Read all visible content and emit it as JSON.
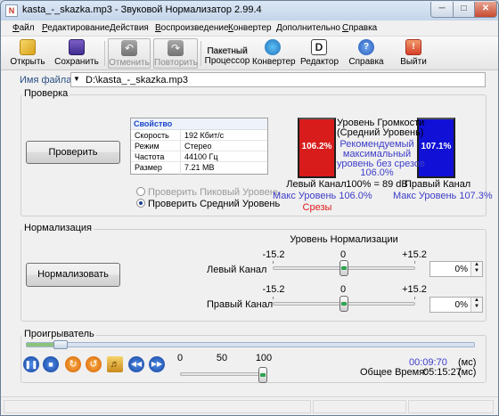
{
  "window": {
    "title": "kasta_-_skazka.mp3 - Звуковой Нормализатор 2.99.4",
    "app_icon_letter": "N",
    "controls": [
      "minimize",
      "maximize",
      "close"
    ]
  },
  "menu": [
    {
      "label": "Файл",
      "underline": "Ф",
      "rest": "айл"
    },
    {
      "label": "Редактирование",
      "underline": "Р",
      "rest": "едактирование"
    },
    {
      "label": "Действия",
      "underline": "Д",
      "rest": "ействия"
    },
    {
      "label": "Воспроизведение",
      "underline": "В",
      "rest": "оспроизведение"
    },
    {
      "label": "Конвертер",
      "underline": "К",
      "rest": "онвертер"
    },
    {
      "label": "Дополнительно",
      "underline": "Д",
      "rest": "ополнительно"
    },
    {
      "label": "Справка",
      "underline": "С",
      "rest": "правка"
    }
  ],
  "toolbar": {
    "open": "Открыть",
    "save": "Сохранить",
    "undo": "Отменить",
    "redo": "Повторить",
    "batch_line1": "Пакетный",
    "batch_line2": "Процессор",
    "converter": "Конвертер",
    "editor": "Редактор",
    "help": "Справка",
    "exit": "Выйти"
  },
  "file": {
    "label": "Имя файла:",
    "value": "D:\\kasta_-_skazka.mp3"
  },
  "check": {
    "group_title": "Проверка",
    "check_button": "Проверить",
    "properties": {
      "header": "Свойство",
      "rows": [
        {
          "key": "Скорость",
          "value": "192 Кбит/с"
        },
        {
          "key": "Режим",
          "value": "Стерео"
        },
        {
          "key": "Частота",
          "value": "44100 Гц"
        },
        {
          "key": "Размер",
          "value": "7.21 MB"
        }
      ]
    },
    "radio_peak": "Проверить Пиковый Уровень",
    "radio_average": "Проверить Средний Уровень",
    "selected_radio": "average",
    "loudness_title_line1": "Уровень Громкости",
    "loudness_title_line2": "(Средний Уровень)",
    "recommend_line1": "Рекомендуемый",
    "recommend_line2": "максимальный",
    "recommend_line3": "уровень без срезов",
    "recommend_value": "106.0%",
    "db_text": "100% = 89 dB",
    "left_meter_value": "106.2%",
    "right_meter_value": "107.1%",
    "left_meter_color": "#d81c1c",
    "right_meter_color": "#1010d6",
    "left_channel": "Левый Канал",
    "right_channel": "Правый Канал",
    "left_max": "Макс Уровень 106.0%",
    "right_max": "Макс Уровень 107.3%",
    "clipping": "Срезы"
  },
  "normalize": {
    "group_title": "Нормализация",
    "normalize_button": "Нормализовать",
    "level_title": "Уровень Нормализации",
    "scale_min": "-15.2",
    "scale_mid": "0",
    "scale_max": "+15.2",
    "left_channel_label": "Левый Канал",
    "right_channel_label": "Правый Канал",
    "left_value": "0%",
    "right_value": "0%",
    "left_level_fraction": 0.5,
    "right_level_fraction": 0.5
  },
  "player": {
    "group_title": "Проигрыватель",
    "seek_fraction": 0.06,
    "volume_labels": [
      "0",
      "50",
      "100"
    ],
    "volume_value": 100,
    "time_elapsed": "00:09:70",
    "time_unit": "(мс)",
    "total_label": "Общее Время:",
    "total_time": "05:15:27",
    "total_unit": "(мс)",
    "buttons": [
      "pause-icon",
      "stop-icon",
      "loop-icon",
      "repeat-icon",
      "volume-icon",
      "previous-icon",
      "next-icon"
    ]
  }
}
